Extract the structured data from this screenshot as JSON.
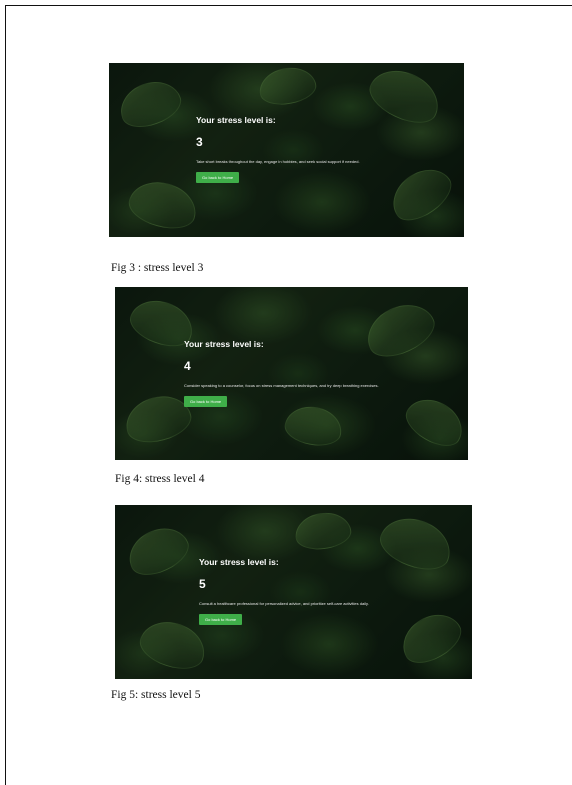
{
  "figures": [
    {
      "heading": "Your stress level is:",
      "level": "3",
      "advice": "Take short breaks throughout the day, engage in hobbies, and seek social support if needed.",
      "button_label": "Go back to Home",
      "caption": "Fig 3 : stress level 3"
    },
    {
      "heading": "Your stress level is:",
      "level": "4",
      "advice": "Consider speaking to a counselor, focus on stress management techniques, and try deep breathing exercises.",
      "button_label": "Go back to Home",
      "caption": "Fig 4: stress level 4"
    },
    {
      "heading": "Your stress level is:",
      "level": "5",
      "advice": "Consult a healthcare professional for personalized advice, and prioritize self-care activities daily.",
      "button_label": "Go back to Home",
      "caption": "Fig 5: stress level 5"
    }
  ],
  "colors": {
    "button_green": "#3fae49",
    "background_dark_green": "#122414",
    "text_white": "#ffffff"
  }
}
